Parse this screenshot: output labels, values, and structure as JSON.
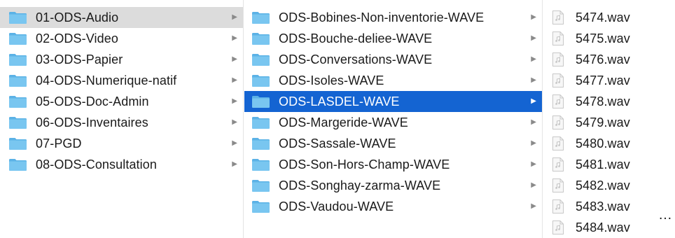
{
  "column1": {
    "items": [
      {
        "label": "01-ODS-Audio",
        "selected": "inactive"
      },
      {
        "label": "02-ODS-Video"
      },
      {
        "label": "03-ODS-Papier"
      },
      {
        "label": "04-ODS-Numerique-natif"
      },
      {
        "label": "05-ODS-Doc-Admin"
      },
      {
        "label": "06-ODS-Inventaires"
      },
      {
        "label": "07-PGD"
      },
      {
        "label": "08-ODS-Consultation"
      }
    ]
  },
  "column2": {
    "items": [
      {
        "label": "ODS-Bobines-Non-inventorie-WAVE"
      },
      {
        "label": "ODS-Bouche-deliee-WAVE"
      },
      {
        "label": "ODS-Conversations-WAVE"
      },
      {
        "label": "ODS-Isoles-WAVE"
      },
      {
        "label": "ODS-LASDEL-WAVE",
        "selected": "active"
      },
      {
        "label": "ODS-Margeride-WAVE"
      },
      {
        "label": "ODS-Sassale-WAVE"
      },
      {
        "label": "ODS-Son-Hors-Champ-WAVE"
      },
      {
        "label": "ODS-Songhay-zarma-WAVE"
      },
      {
        "label": "ODS-Vaudou-WAVE"
      }
    ]
  },
  "column3": {
    "items": [
      {
        "label": "5474.wav"
      },
      {
        "label": "5475.wav"
      },
      {
        "label": "5476.wav"
      },
      {
        "label": "5477.wav"
      },
      {
        "label": "5478.wav"
      },
      {
        "label": "5479.wav"
      },
      {
        "label": "5480.wav"
      },
      {
        "label": "5481.wav"
      },
      {
        "label": "5482.wav"
      },
      {
        "label": "5483.wav"
      },
      {
        "label": "5484.wav"
      }
    ]
  },
  "ellipsis": "…",
  "icons": {
    "folder": "folder-icon",
    "file": "audio-file-icon",
    "chevron": "chevron-right-icon"
  },
  "colors": {
    "selection_active": "#1464d2",
    "selection_inactive": "#dcdcdc",
    "folder": "#6cc0ee"
  }
}
